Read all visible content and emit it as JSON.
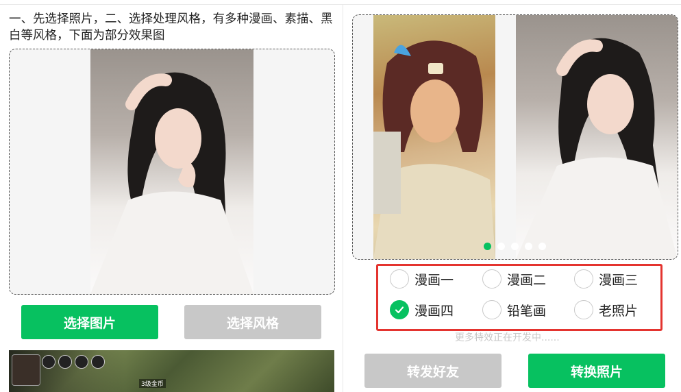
{
  "left": {
    "intro": "一、先选择照片，二、选择处理风格，有多种漫画、素描、黑白等风格，下面为部分效果图",
    "select_photo_label": "选择图片",
    "select_style_label": "选择风格",
    "banner_label": "3级金币"
  },
  "right": {
    "carousel": {
      "count": 5,
      "active_index": 0
    },
    "options": [
      {
        "label": "漫画一",
        "checked": false
      },
      {
        "label": "漫画二",
        "checked": false
      },
      {
        "label": "漫画三",
        "checked": false
      },
      {
        "label": "漫画四",
        "checked": true
      },
      {
        "label": "铅笔画",
        "checked": false
      },
      {
        "label": "老照片",
        "checked": false
      }
    ],
    "dev_note": "更多特效正在开发中......",
    "forward_label": "转发好友",
    "convert_label": "转换照片"
  },
  "colors": {
    "primary": "#07c160",
    "disabled": "#c8c8c8",
    "highlight": "#e4342f"
  },
  "icons": {
    "check": "check-icon"
  }
}
